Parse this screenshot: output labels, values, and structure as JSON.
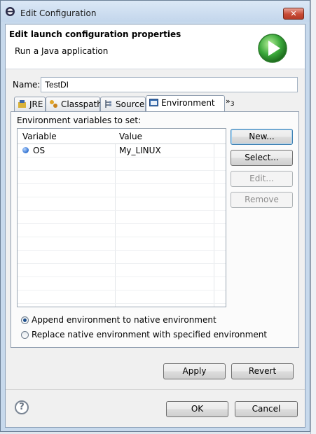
{
  "window": {
    "title": "Edit Configuration",
    "close_label": "✕"
  },
  "header": {
    "title": "Edit launch configuration properties",
    "subtitle": "Run a Java application"
  },
  "name": {
    "label": "Name:",
    "value": "TestDI"
  },
  "tabs": [
    {
      "label": "JRE",
      "icon": "jre-icon"
    },
    {
      "label": "Classpath",
      "icon": "classpath-icon"
    },
    {
      "label": "Source",
      "icon": "source-icon"
    },
    {
      "label": "Environment",
      "icon": "environment-icon",
      "active": true
    }
  ],
  "tabs_overflow": {
    "label": "»",
    "count": "3"
  },
  "environment": {
    "section_label": "Environment variables to set:",
    "columns": [
      "Variable",
      "Value"
    ],
    "rows": [
      {
        "variable": "OS",
        "value": "My_LINUX"
      }
    ],
    "buttons": {
      "new": "New...",
      "select": "Select...",
      "edit": "Edit...",
      "remove": "Remove"
    },
    "options": {
      "append": "Append environment to native environment",
      "replace": "Replace native environment with specified environment",
      "selected": "append"
    }
  },
  "actions": {
    "apply": "Apply",
    "revert": "Revert"
  },
  "footer": {
    "ok": "OK",
    "cancel": "Cancel",
    "help_symbol": "?"
  },
  "colors": {
    "accent": "#3c7fb1",
    "run_icon": "#3aa83a",
    "close_button": "#c84b35"
  }
}
